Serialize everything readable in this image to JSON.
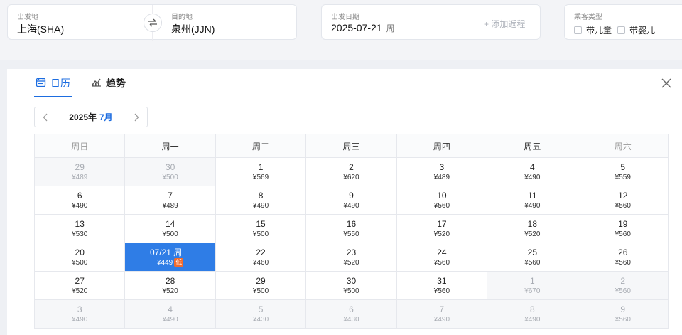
{
  "search": {
    "origin_label": "出发地",
    "origin_value": "上海(SHA)",
    "destination_label": "目的地",
    "destination_value": "泉州(JJN)",
    "date_label": "出发日期",
    "date_value": "2025-07-21",
    "date_weekday": "周一",
    "add_return": "+ 添加返程",
    "passenger_label": "乘客类型",
    "child_option": "带儿童",
    "infant_option": "带婴儿"
  },
  "tabs": {
    "calendar": "日历",
    "trend": "趋势"
  },
  "month_nav": {
    "year": "2025年",
    "month": "7月"
  },
  "calendar": {
    "weekdays": [
      "周日",
      "周一",
      "周二",
      "周三",
      "周四",
      "周五",
      "周六"
    ],
    "weeks": [
      [
        {
          "day": "29",
          "price": "¥489",
          "other": true
        },
        {
          "day": "30",
          "price": "¥500",
          "other": true
        },
        {
          "day": "1",
          "price": "¥569"
        },
        {
          "day": "2",
          "price": "¥620"
        },
        {
          "day": "3",
          "price": "¥489"
        },
        {
          "day": "4",
          "price": "¥490"
        },
        {
          "day": "5",
          "price": "¥559"
        }
      ],
      [
        {
          "day": "6",
          "price": "¥490"
        },
        {
          "day": "7",
          "price": "¥489"
        },
        {
          "day": "8",
          "price": "¥490"
        },
        {
          "day": "9",
          "price": "¥490"
        },
        {
          "day": "10",
          "price": "¥560"
        },
        {
          "day": "11",
          "price": "¥490"
        },
        {
          "day": "12",
          "price": "¥560"
        }
      ],
      [
        {
          "day": "13",
          "price": "¥530"
        },
        {
          "day": "14",
          "price": "¥500"
        },
        {
          "day": "15",
          "price": "¥500"
        },
        {
          "day": "16",
          "price": "¥550"
        },
        {
          "day": "17",
          "price": "¥520"
        },
        {
          "day": "18",
          "price": "¥520"
        },
        {
          "day": "19",
          "price": "¥560"
        }
      ],
      [
        {
          "day": "20",
          "price": "¥500"
        },
        {
          "day": "07/21 周一",
          "price": "¥449",
          "selected": true,
          "badge": "低"
        },
        {
          "day": "22",
          "price": "¥460"
        },
        {
          "day": "23",
          "price": "¥520"
        },
        {
          "day": "24",
          "price": "¥560"
        },
        {
          "day": "25",
          "price": "¥560"
        },
        {
          "day": "26",
          "price": "¥560"
        }
      ],
      [
        {
          "day": "27",
          "price": "¥520"
        },
        {
          "day": "28",
          "price": "¥520"
        },
        {
          "day": "29",
          "price": "¥500"
        },
        {
          "day": "30",
          "price": "¥500"
        },
        {
          "day": "31",
          "price": "¥560"
        },
        {
          "day": "1",
          "price": "¥670",
          "other": true
        },
        {
          "day": "2",
          "price": "¥560",
          "other": true
        }
      ],
      [
        {
          "day": "3",
          "price": "¥490",
          "other": true
        },
        {
          "day": "4",
          "price": "¥490",
          "other": true
        },
        {
          "day": "5",
          "price": "¥430",
          "other": true
        },
        {
          "day": "6",
          "price": "¥430",
          "other": true
        },
        {
          "day": "7",
          "price": "¥490",
          "other": true
        },
        {
          "day": "8",
          "price": "¥490",
          "other": true
        },
        {
          "day": "9",
          "price": "¥560",
          "other": true
        }
      ]
    ]
  },
  "icons": {
    "swap": "swap-arrows-icon",
    "calendar": "calendar-icon",
    "trend": "trend-chart-icon",
    "close": "close-icon",
    "prev": "chevron-left-icon",
    "next": "chevron-right-icon"
  },
  "colors": {
    "accent": "#1d6de0",
    "selected_bg": "#2f7de6",
    "badge": "#f26b2d"
  }
}
